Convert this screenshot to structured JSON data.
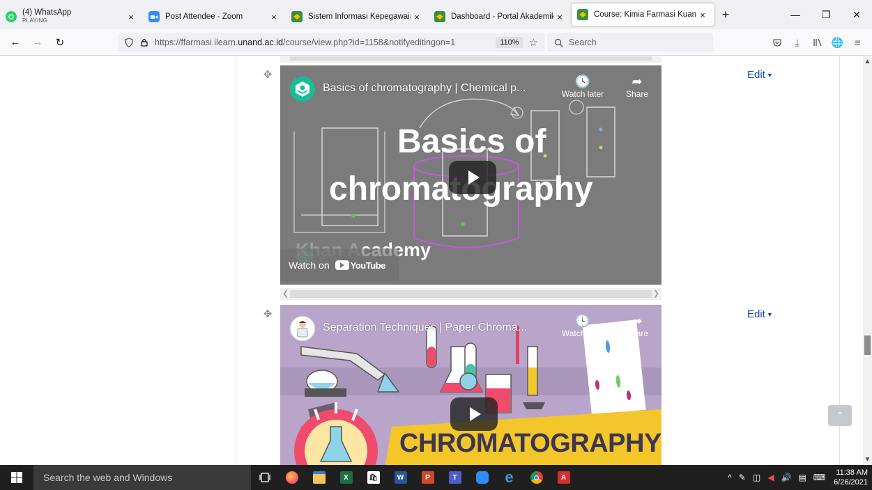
{
  "browser": {
    "tabs": [
      {
        "title": "(4) WhatsApp",
        "subtitle": "PLAYING",
        "icon": "whatsapp-icon",
        "color": "#25d366"
      },
      {
        "title": "Post Attendee - Zoom",
        "icon": "zoom-icon",
        "color": "#2d8cff"
      },
      {
        "title": "Sistem Informasi Kepegawaian |",
        "icon": "unand-icon",
        "color": "#3a8f3a"
      },
      {
        "title": "Dashboard - Portal Akademik U",
        "icon": "unand-icon",
        "color": "#3a8f3a"
      },
      {
        "title": "Course: Kimia Farmasi Kuantita",
        "icon": "moodle-icon",
        "color": "#3a8f3a"
      }
    ],
    "close_glyph": "×",
    "new_tab_glyph": "+",
    "url_prefix": "https://ffarmasi.ilearn.",
    "url_domain": "unand.ac.id",
    "url_path": "/course/view.php?id=1158&notifyeditingon=1",
    "zoom": "110%",
    "search_placeholder": "Search"
  },
  "course": {
    "edit_label": "Edit",
    "videos": [
      {
        "title": "Basics of chromatography | Chemical p...",
        "watch_later": "Watch later",
        "share": "Share",
        "overlay_line1": "Basics of",
        "overlay_line2": "chromatography",
        "watch_on": "Watch on",
        "youtube": "YouTube",
        "brand_partial": "Khan A",
        "brand_suffix": "cademy"
      },
      {
        "title": "Separation Techniques | Paper Chroma...",
        "watch_later": "Watch later",
        "share": "Share",
        "overlay": "CHROMATOGRAPHY"
      }
    ]
  },
  "taskbar": {
    "search_placeholder": "Search the web and Windows",
    "time": "11:38 AM",
    "date": "6/26/2021",
    "tray_caret": "^"
  }
}
